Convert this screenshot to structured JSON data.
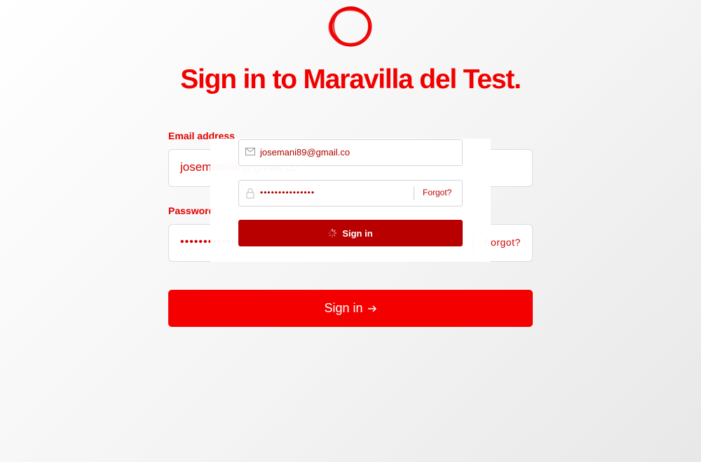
{
  "brand": {
    "title": "Sign in to Maravilla del Test.",
    "logo_icon": "red-ring-logo",
    "accent_color": "#f40000"
  },
  "form": {
    "email_label": "Email address",
    "email_value": "josemani89@gmail.co",
    "password_label": "Password",
    "password_masked": "••••••••••••••",
    "forgot_label": "Forgot?",
    "submit_label": "Sign in",
    "submit_icon": "arrow-right-icon"
  },
  "overlay": {
    "email_value": "josemani89@gmail.co",
    "email_icon": "mail-icon",
    "password_masked": "•••••••••••••••",
    "lock_icon": "lock-icon",
    "forgot_label": "Forgot?",
    "submit_label": "Sign in",
    "spinner_icon": "loading-spinner-icon"
  }
}
